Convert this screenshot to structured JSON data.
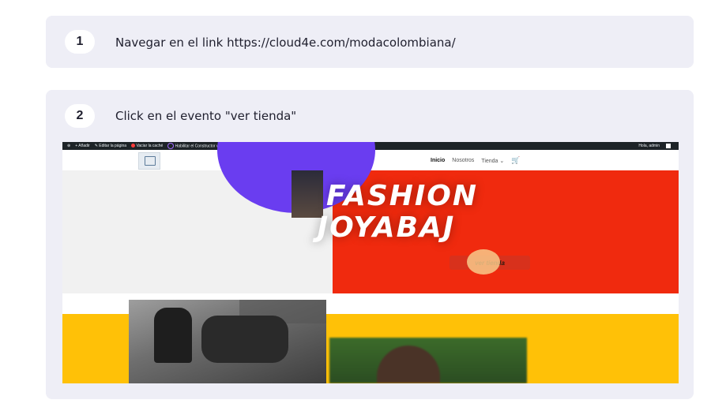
{
  "steps": [
    {
      "number": "1",
      "text": "Navegar en el link https://cloud4e.com/modacolombiana/"
    },
    {
      "number": "2",
      "text": "Click en el evento \"ver tienda\""
    }
  ],
  "screenshot": {
    "admin_bar": {
      "items": [
        "Añadir",
        "Editar la página",
        "Vaciar la caché",
        "Habilitar el Constructor visual"
      ],
      "greeting": "Hola, admin"
    },
    "nav": {
      "links": [
        "Inicio",
        "Nosotros",
        "Tienda"
      ],
      "dropdown_caret": "⌄"
    },
    "hero": {
      "title_line1": "FASHION",
      "title_line2": "JOYABAJ",
      "button_label": "ver tienda"
    }
  },
  "colors": {
    "card_bg": "#eeeef6",
    "admin_bar": "#1d2327",
    "hero_red": "#f02a0e",
    "hero_purple": "#6a3df0",
    "band_yellow": "#ffc107",
    "cart": "#8b2bd6"
  },
  "icons": [
    "wordpress-icon",
    "cart-icon",
    "search-icon"
  ]
}
